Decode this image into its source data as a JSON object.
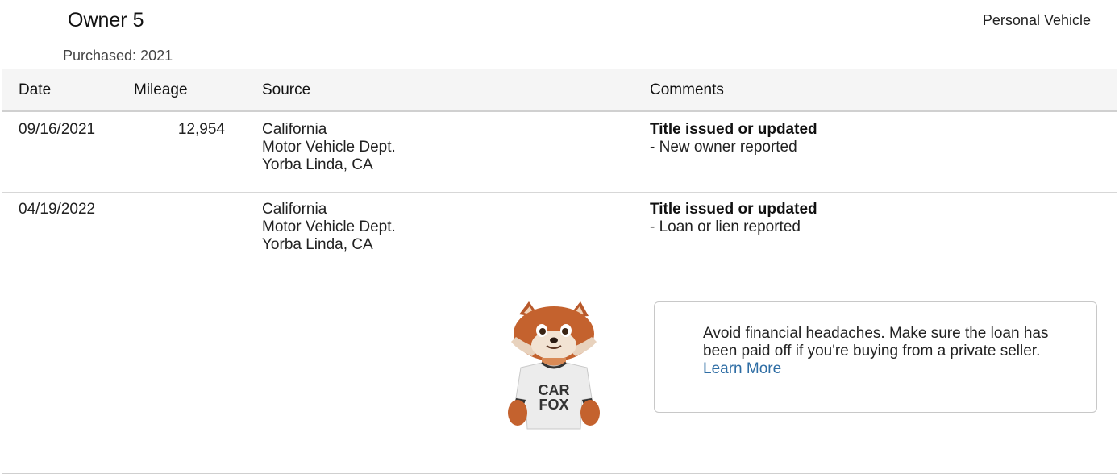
{
  "owner": {
    "title": "Owner 5",
    "purchased": "Purchased: 2021",
    "vehicle_type": "Personal Vehicle"
  },
  "table": {
    "headers": [
      "Date",
      "Mileage",
      "Source",
      "Comments"
    ],
    "rows": [
      {
        "date": "09/16/2021",
        "mileage": "12,954",
        "source": [
          "California",
          "Motor Vehicle Dept.",
          "Yorba Linda, CA"
        ],
        "comment_title": "Title issued or updated",
        "comment_detail": "- New owner reported"
      },
      {
        "date": "04/19/2022",
        "mileage": "",
        "source": [
          "California",
          "Motor Vehicle Dept.",
          "Yorba Linda, CA"
        ],
        "comment_title": "Title issued or updated",
        "comment_detail": "- Loan or lien reported"
      }
    ]
  },
  "tip": {
    "text": "Avoid financial headaches. Make sure the loan has been paid off if you're buying from a private seller.",
    "link_label": "Learn More"
  },
  "mascot": {
    "shirt_text": [
      "CAR",
      "FOX"
    ]
  },
  "colors": {
    "link": "#2e6da4",
    "border": "#cfcfcf",
    "header_bg": "#f5f5f5"
  }
}
